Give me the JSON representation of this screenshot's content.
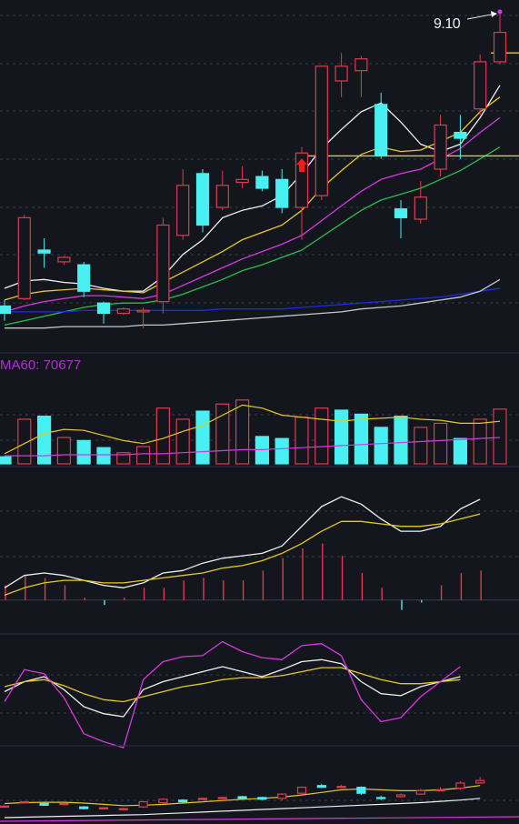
{
  "colors": {
    "background": "#14161e",
    "grid": "#3a3f4b",
    "up": "#e03a4e",
    "down": "#48f0f2",
    "white": "#f0f0f0",
    "yellow": "#e8c81c",
    "magenta": "#d838e0",
    "green": "#22c04a",
    "gray": "#c8c8c8",
    "blue": "#1a2ce8",
    "purple_label": "#b030d0",
    "signal_red": "#ff1a1a"
  },
  "price_panel": {
    "max_annotation": "9.10",
    "max_marker": "arrow-icon",
    "buy_signal_icon": "red-up-arrow-icon"
  },
  "volume_panel": {
    "label": "MA60: 70677"
  },
  "chart_data": [
    {
      "type": "candlestick",
      "panel": "price",
      "candles": [
        {
          "o": 7.1,
          "c": 7.05,
          "h": 7.14,
          "l": 7.0
        },
        {
          "o": 7.15,
          "c": 7.7,
          "h": 7.72,
          "l": 7.14
        },
        {
          "o": 7.48,
          "c": 7.46,
          "h": 7.56,
          "l": 7.36
        },
        {
          "o": 7.4,
          "c": 7.43,
          "h": 7.44,
          "l": 7.38
        },
        {
          "o": 7.38,
          "c": 7.2,
          "h": 7.4,
          "l": 7.16
        },
        {
          "o": 7.12,
          "c": 7.05,
          "h": 7.13,
          "l": 6.98
        },
        {
          "o": 7.05,
          "c": 7.08,
          "h": 7.09,
          "l": 7.04
        },
        {
          "o": 7.06,
          "c": 7.07,
          "h": 7.09,
          "l": 6.95
        },
        {
          "o": 7.13,
          "c": 7.65,
          "h": 7.7,
          "l": 7.05
        },
        {
          "o": 7.58,
          "c": 7.92,
          "h": 8.03,
          "l": 7.55
        },
        {
          "o": 8.0,
          "c": 7.65,
          "h": 8.03,
          "l": 7.6
        },
        {
          "o": 7.77,
          "c": 7.92,
          "h": 8.02,
          "l": 7.75
        },
        {
          "o": 7.94,
          "c": 7.96,
          "h": 8.05,
          "l": 7.9
        },
        {
          "o": 7.98,
          "c": 7.9,
          "h": 8.02,
          "l": 7.88
        },
        {
          "o": 7.96,
          "c": 7.77,
          "h": 8.03,
          "l": 7.73
        },
        {
          "o": 7.77,
          "c": 8.14,
          "h": 8.18,
          "l": 7.55
        },
        {
          "o": 7.85,
          "c": 8.73,
          "h": 8.73,
          "l": 7.82
        },
        {
          "o": 8.63,
          "c": 8.73,
          "h": 8.82,
          "l": 8.52
        },
        {
          "o": 8.7,
          "c": 8.78,
          "h": 8.8,
          "l": 8.52
        },
        {
          "o": 8.47,
          "c": 8.12,
          "h": 8.55,
          "l": 8.1
        },
        {
          "o": 7.76,
          "c": 7.7,
          "h": 7.82,
          "l": 7.56
        },
        {
          "o": 7.69,
          "c": 7.84,
          "h": 7.95,
          "l": 7.66
        },
        {
          "o": 8.03,
          "c": 8.33,
          "h": 8.4,
          "l": 7.98
        },
        {
          "o": 8.28,
          "c": 8.24,
          "h": 8.4,
          "l": 8.1
        },
        {
          "o": 8.44,
          "c": 8.76,
          "h": 8.81,
          "l": 8.4
        },
        {
          "o": 8.76,
          "c": 8.96,
          "h": 9.1,
          "l": 8.74
        }
      ],
      "moving_averages": [
        {
          "color": "white",
          "values": [
            7.22,
            7.27,
            7.28,
            7.26,
            7.25,
            7.22,
            7.2,
            7.2,
            7.3,
            7.45,
            7.55,
            7.7,
            7.75,
            7.78,
            7.85,
            8.0,
            8.17,
            8.3,
            8.42,
            8.48,
            8.35,
            8.2,
            8.15,
            8.2,
            8.38,
            8.6
          ]
        },
        {
          "color": "yellow",
          "values": [
            7.14,
            7.18,
            7.2,
            7.21,
            7.22,
            7.21,
            7.2,
            7.19,
            7.26,
            7.33,
            7.4,
            7.47,
            7.55,
            7.6,
            7.65,
            7.75,
            7.9,
            8.02,
            8.13,
            8.18,
            8.15,
            8.16,
            8.22,
            8.28,
            8.42,
            8.52
          ]
        },
        {
          "color": "magenta",
          "values": [
            7.06,
            7.1,
            7.13,
            7.15,
            7.17,
            7.17,
            7.16,
            7.15,
            7.18,
            7.24,
            7.3,
            7.36,
            7.42,
            7.47,
            7.52,
            7.58,
            7.68,
            7.78,
            7.88,
            7.96,
            8.0,
            8.03,
            8.1,
            8.17,
            8.28,
            8.38
          ]
        },
        {
          "color": "green",
          "values": [
            6.97,
            7.0,
            7.03,
            7.06,
            7.09,
            7.11,
            7.12,
            7.12,
            7.14,
            7.18,
            7.23,
            7.28,
            7.34,
            7.38,
            7.43,
            7.48,
            7.57,
            7.66,
            7.75,
            7.82,
            7.86,
            7.9,
            7.96,
            8.02,
            8.1,
            8.18
          ]
        },
        {
          "color": "blue",
          "values": [
            7.06,
            7.06,
            7.06,
            7.06,
            7.07,
            7.07,
            7.07,
            7.07,
            7.07,
            7.07,
            7.07,
            7.08,
            7.08,
            7.08,
            7.08,
            7.09,
            7.1,
            7.11,
            7.12,
            7.13,
            7.14,
            7.15,
            7.16,
            7.18,
            7.2,
            7.22
          ]
        },
        {
          "color": "gray",
          "values": [
            6.95,
            6.95,
            6.95,
            6.96,
            6.96,
            6.96,
            6.96,
            6.97,
            6.97,
            6.98,
            6.99,
            7.0,
            7.01,
            7.02,
            7.03,
            7.04,
            7.05,
            7.06,
            7.08,
            7.09,
            7.1,
            7.12,
            7.14,
            7.16,
            7.2,
            7.28
          ]
        }
      ],
      "reference_lines": [
        8.82,
        8.12
      ],
      "ylim": [
        6.88,
        9.18
      ]
    },
    {
      "type": "bar",
      "panel": "volume",
      "values": [
        7,
        44,
        47,
        26,
        23,
        16,
        11,
        17,
        55,
        44,
        52,
        59,
        63,
        27,
        25,
        46,
        55,
        53,
        49,
        36,
        47,
        36,
        40,
        25,
        44,
        54
      ],
      "directions": [
        "down",
        "up",
        "down",
        "up",
        "down",
        "down",
        "up",
        "up",
        "up",
        "up",
        "down",
        "up",
        "up",
        "down",
        "down",
        "up",
        "up",
        "down",
        "down",
        "down",
        "down",
        "up",
        "up",
        "down",
        "up",
        "up"
      ],
      "moving_averages": [
        {
          "color": "yellow",
          "values": [
            10,
            20,
            30,
            34,
            33,
            28,
            23,
            20,
            25,
            32,
            38,
            48,
            58,
            55,
            48,
            46,
            44,
            42,
            44,
            45,
            46,
            44,
            43,
            40,
            40,
            42
          ]
        },
        {
          "color": "magenta",
          "values": [
            8,
            8,
            8,
            9,
            9,
            9,
            9,
            10,
            10,
            11,
            12,
            13,
            14,
            14,
            15,
            16,
            17,
            18,
            19,
            20,
            21,
            22,
            23,
            24,
            25,
            26
          ]
        }
      ],
      "ylim": [
        0,
        70
      ]
    },
    {
      "type": "line",
      "panel": "macd",
      "series": [
        {
          "color": "white",
          "values": [
            0.05,
            0.1,
            0.11,
            0.1,
            0.08,
            0.06,
            0.05,
            0.07,
            0.11,
            0.12,
            0.15,
            0.17,
            0.18,
            0.19,
            0.22,
            0.3,
            0.38,
            0.42,
            0.39,
            0.33,
            0.28,
            0.28,
            0.3,
            0.37,
            0.41
          ]
        },
        {
          "color": "yellow",
          "values": [
            0.02,
            0.05,
            0.07,
            0.08,
            0.08,
            0.07,
            0.07,
            0.08,
            0.09,
            0.1,
            0.11,
            0.13,
            0.14,
            0.16,
            0.19,
            0.23,
            0.28,
            0.32,
            0.32,
            0.31,
            0.3,
            0.3,
            0.31,
            0.33,
            0.35
          ]
        }
      ],
      "bars": [
        0.06,
        0.1,
        0.09,
        0.06,
        0.01,
        -0.02,
        0.01,
        0.05,
        0.05,
        0.08,
        0.09,
        0.08,
        0.08,
        0.12,
        0.17,
        0.21,
        0.23,
        0.18,
        0.11,
        0.05,
        -0.04,
        -0.01,
        0.06,
        0.11,
        0.12
      ],
      "ylim": [
        -0.06,
        0.48
      ]
    },
    {
      "type": "line",
      "panel": "kdj",
      "series": [
        {
          "color": "white",
          "values": [
            50,
            60,
            65,
            52,
            35,
            28,
            25,
            52,
            60,
            65,
            70,
            75,
            70,
            65,
            72,
            80,
            82,
            78,
            60,
            48,
            46,
            55,
            60,
            65
          ]
        },
        {
          "color": "yellow",
          "values": [
            55,
            60,
            62,
            56,
            48,
            42,
            40,
            45,
            50,
            55,
            58,
            62,
            64,
            64,
            66,
            70,
            74,
            74,
            68,
            62,
            58,
            58,
            60,
            62
          ]
        },
        {
          "color": "magenta",
          "values": [
            40,
            72,
            68,
            44,
            8,
            0,
            -6,
            62,
            80,
            85,
            86,
            100,
            90,
            84,
            82,
            96,
            98,
            86,
            42,
            20,
            24,
            45,
            60,
            75
          ]
        }
      ],
      "ylim": [
        -15,
        105
      ]
    },
    {
      "type": "candlestick",
      "panel": "mini",
      "candles": [
        {
          "o": 0.3,
          "c": 0.32,
          "h": 0.34,
          "l": 0.28
        },
        {
          "o": 0.4,
          "c": 0.42,
          "h": 0.44,
          "l": 0.38
        },
        {
          "o": 0.38,
          "c": 0.34,
          "h": 0.4,
          "l": 0.33
        },
        {
          "o": 0.36,
          "c": 0.38,
          "h": 0.4,
          "l": 0.34
        },
        {
          "o": 0.3,
          "c": 0.26,
          "h": 0.32,
          "l": 0.24
        },
        {
          "o": 0.26,
          "c": 0.28,
          "h": 0.3,
          "l": 0.25
        },
        {
          "o": 0.24,
          "c": 0.26,
          "h": 0.28,
          "l": 0.22
        },
        {
          "o": 0.3,
          "c": 0.42,
          "h": 0.44,
          "l": 0.28
        },
        {
          "o": 0.4,
          "c": 0.48,
          "h": 0.5,
          "l": 0.38
        },
        {
          "o": 0.46,
          "c": 0.42,
          "h": 0.48,
          "l": 0.4
        },
        {
          "o": 0.48,
          "c": 0.5,
          "h": 0.52,
          "l": 0.46
        },
        {
          "o": 0.5,
          "c": 0.52,
          "h": 0.54,
          "l": 0.49
        },
        {
          "o": 0.54,
          "c": 0.5,
          "h": 0.56,
          "l": 0.48
        },
        {
          "o": 0.52,
          "c": 0.48,
          "h": 0.54,
          "l": 0.46
        },
        {
          "o": 0.5,
          "c": 0.6,
          "h": 0.62,
          "l": 0.45
        },
        {
          "o": 0.62,
          "c": 0.76,
          "h": 0.78,
          "l": 0.6
        },
        {
          "o": 0.8,
          "c": 0.76,
          "h": 0.84,
          "l": 0.74
        },
        {
          "o": 0.78,
          "c": 0.78,
          "h": 0.82,
          "l": 0.74
        },
        {
          "o": 0.76,
          "c": 0.62,
          "h": 0.78,
          "l": 0.58
        },
        {
          "o": 0.52,
          "c": 0.5,
          "h": 0.56,
          "l": 0.46
        },
        {
          "o": 0.54,
          "c": 0.58,
          "h": 0.62,
          "l": 0.52
        },
        {
          "o": 0.6,
          "c": 0.68,
          "h": 0.72,
          "l": 0.58
        },
        {
          "o": 0.7,
          "c": 0.7,
          "h": 0.76,
          "l": 0.68
        },
        {
          "o": 0.74,
          "c": 0.86,
          "h": 0.9,
          "l": 0.7
        },
        {
          "o": 0.86,
          "c": 0.92,
          "h": 1.0,
          "l": 0.84
        }
      ],
      "moving_averages": [
        {
          "color": "yellow",
          "values": [
            0.38,
            0.4,
            0.41,
            0.41,
            0.39,
            0.36,
            0.33,
            0.34,
            0.36,
            0.39,
            0.42,
            0.45,
            0.48,
            0.5,
            0.53,
            0.58,
            0.64,
            0.7,
            0.72,
            0.7,
            0.68,
            0.68,
            0.7,
            0.74,
            0.8
          ]
        },
        {
          "color": "white",
          "values": [
            0.05,
            0.06,
            0.07,
            0.08,
            0.09,
            0.1,
            0.11,
            0.12,
            0.14,
            0.16,
            0.18,
            0.2,
            0.22,
            0.24,
            0.26,
            0.28,
            0.3,
            0.32,
            0.34,
            0.36,
            0.38,
            0.4,
            0.43,
            0.46,
            0.5
          ]
        }
      ],
      "ylim": [
        -0.1,
        1.05
      ]
    }
  ]
}
